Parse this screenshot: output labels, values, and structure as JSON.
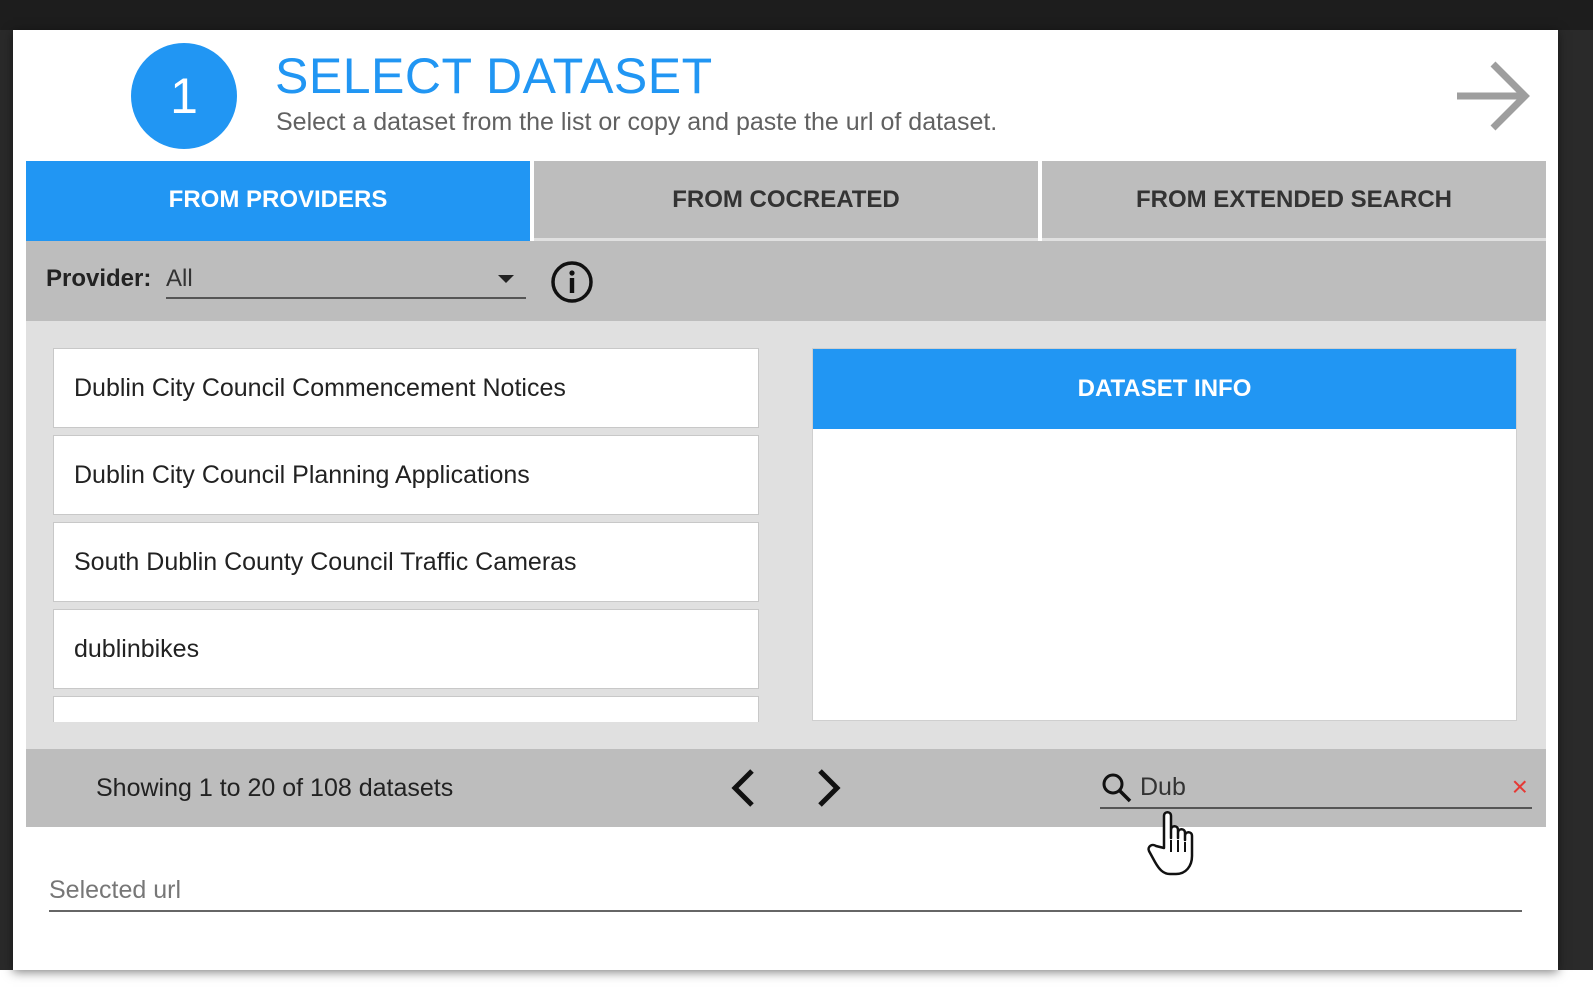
{
  "header": {
    "step_number": "1",
    "title": "SELECT DATASET",
    "subtitle": "Select a dataset from the list or copy and paste the url of dataset."
  },
  "tabs": [
    {
      "label": "FROM PROVIDERS",
      "active": true
    },
    {
      "label": "FROM COCREATED",
      "active": false
    },
    {
      "label": "FROM EXTENDED SEARCH",
      "active": false
    }
  ],
  "provider": {
    "label": "Provider:",
    "selected": "All"
  },
  "datasets": [
    {
      "name": "Dublin City Council Commencement Notices"
    },
    {
      "name": "Dublin City Council Planning Applications"
    },
    {
      "name": "South Dublin County Council Traffic Cameras"
    },
    {
      "name": "dublinbikes"
    },
    {
      "name": ""
    }
  ],
  "info_panel": {
    "title": "DATASET INFO"
  },
  "footer": {
    "showing_text": "Showing 1 to 20 of 108 datasets",
    "search_value": "Dub",
    "clear_symbol": "×"
  },
  "selected_url": {
    "placeholder": "Selected url",
    "value": ""
  },
  "colors": {
    "accent": "#2196f3",
    "bar_gray": "#bdbdbd",
    "clear_red": "#e53935"
  },
  "icons": [
    "next-arrow-icon",
    "info-icon",
    "chevron-left-icon",
    "chevron-right-icon",
    "search-icon",
    "clear-icon",
    "hand-cursor-icon"
  ]
}
